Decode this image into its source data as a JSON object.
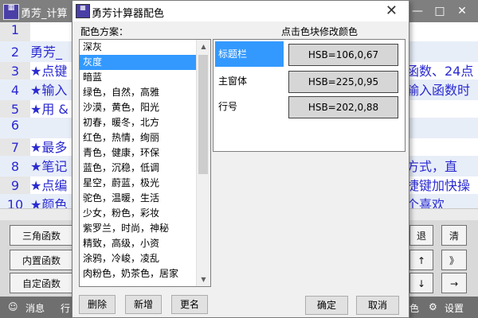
{
  "main_window": {
    "title": "勇芳_计算",
    "window_buttons": [
      "—",
      "□",
      "✕"
    ],
    "editor_lines": [
      {
        "num": "1",
        "text": ""
      },
      {
        "num": "2",
        "text": "勇芳_"
      },
      {
        "num": "3",
        "text": "★点键"
      },
      {
        "num": "4",
        "text": "★输入"
      },
      {
        "num": "5",
        "text": "★用 &"
      },
      {
        "num": "6",
        "text": ""
      },
      {
        "num": "7",
        "text": "★最多"
      },
      {
        "num": "8",
        "text": "★笔记"
      },
      {
        "num": "9",
        "text": "★点编"
      },
      {
        "num": "10",
        "text": "★颜色"
      }
    ],
    "editor_right_text": [
      "函数、24点",
      "输入函数时",
      "方式，直",
      "捷键加快操",
      "个喜欢"
    ],
    "function_buttons": [
      "三角函数",
      "内置函数",
      "自定函数"
    ],
    "key_buttons": [
      "退",
      "清",
      "↑",
      "》",
      "↓",
      "→"
    ],
    "status": {
      "messages": "消息",
      "row": "行",
      "color": "色",
      "settings": "设置"
    }
  },
  "dialog": {
    "title": "勇芳计算器配色",
    "close_label": "✕",
    "scheme_label": "配色方案：",
    "edit_label": "点击色块修改颜色",
    "schemes": [
      "深灰",
      "灰度",
      "暗蓝",
      "绿色，自然，高雅",
      "沙漠，黄色，阳光",
      "初春，暖冬，北方",
      "红色，热情，绚丽",
      "青色，健康，环保",
      "蓝色，沉稳，低调",
      "星空，蔚蓝，极光",
      "驼色，温暖，生活",
      "少女，粉色，彩妆",
      "紫罗兰，时尚，神秘",
      "精致，高级，小资",
      "涂鸦，冷峻，凌乱",
      "肉粉色，奶茶色，居家"
    ],
    "selected_scheme": "灰度",
    "color_rows": [
      {
        "name": "标题栏",
        "value": "HSB=106,0,67"
      },
      {
        "name": "主窗体",
        "value": "HSB=225,0,95"
      },
      {
        "name": "行号",
        "value": "HSB=202,0,88"
      }
    ],
    "buttons": {
      "delete": "删除",
      "add": "新增",
      "rename": "更名",
      "ok": "确定",
      "cancel": "取消"
    }
  }
}
